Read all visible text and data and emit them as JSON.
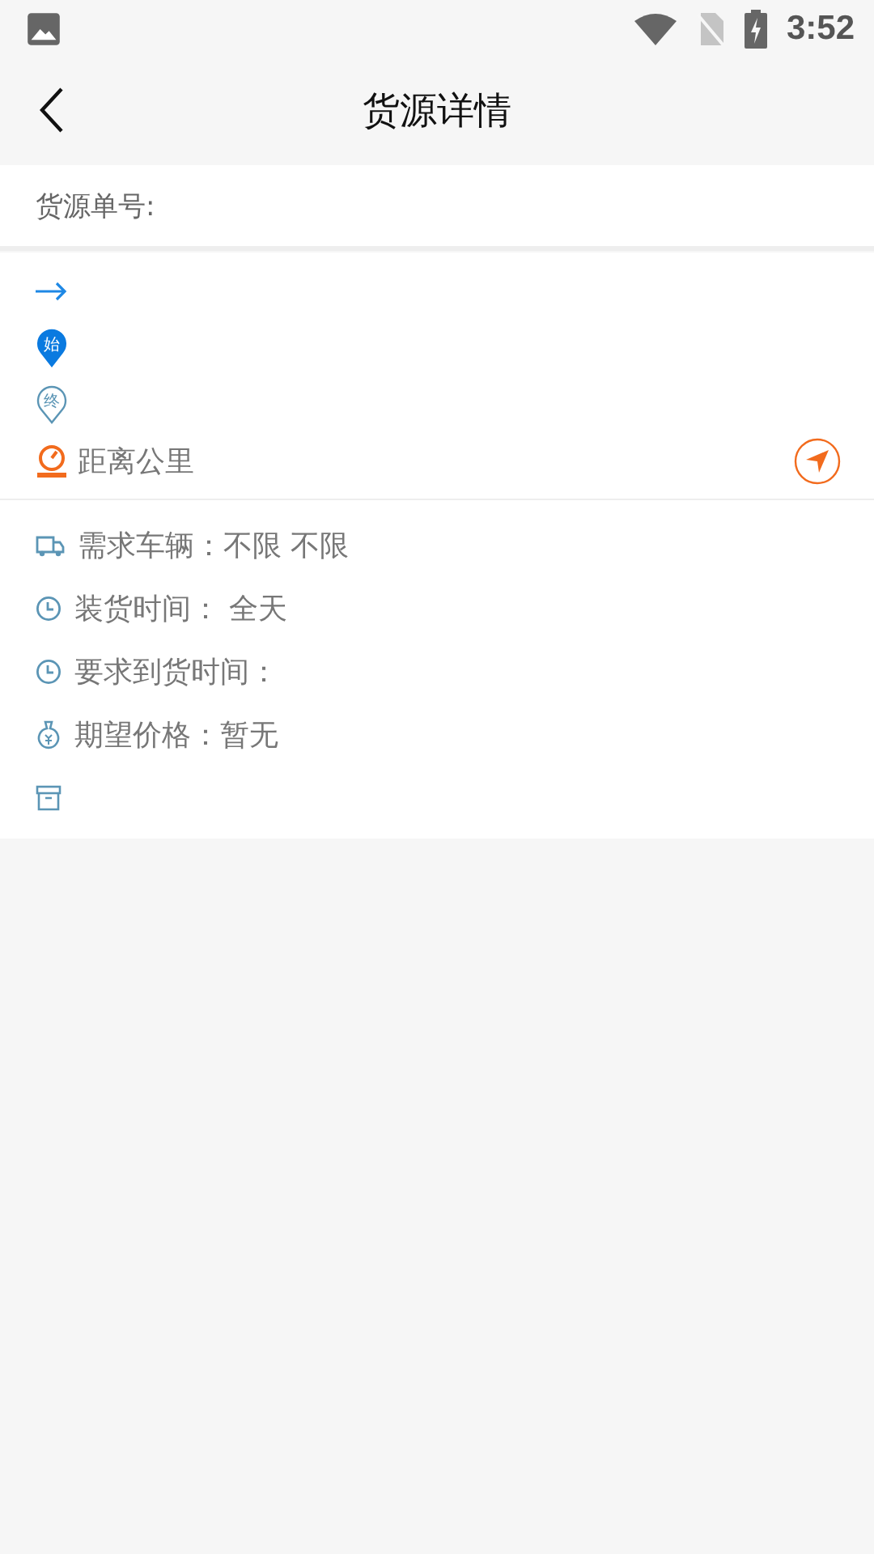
{
  "status_bar": {
    "time": "3:52"
  },
  "header": {
    "title": "货源详情"
  },
  "order": {
    "label": "货源单号:"
  },
  "route": [
    {
      "kind": "arrow"
    },
    {
      "kind": "start",
      "marker": "始"
    },
    {
      "kind": "end",
      "marker": "终"
    },
    {
      "kind": "distance",
      "text": "距离公里"
    }
  ],
  "details": [
    {
      "kind": "vehicle",
      "text": "需求车辆：不限 不限"
    },
    {
      "kind": "clock",
      "text": "装货时间：  全天"
    },
    {
      "kind": "clock",
      "text": "要求到货时间："
    },
    {
      "kind": "price",
      "text": "期望价格：暂无"
    },
    {
      "kind": "box"
    }
  ]
}
